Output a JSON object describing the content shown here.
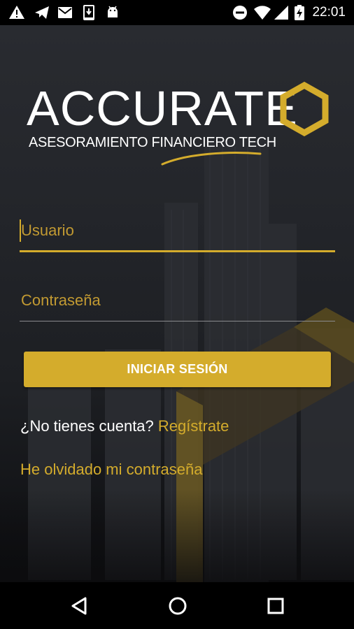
{
  "status_bar": {
    "left_icons": [
      "warning-icon",
      "send-icon",
      "mail-icon",
      "download-icon",
      "android-icon"
    ],
    "right_icons": [
      "do-not-disturb-icon",
      "wifi-icon",
      "signal-icon",
      "battery-charging-icon"
    ],
    "time": "22:01"
  },
  "logo": {
    "title": "ACCURATE",
    "subtitle": "ASESORAMIENTO FINANCIERO TECH",
    "mark_icon": "hexagon-logo-icon",
    "brand_color": "#d4ac2c"
  },
  "form": {
    "username_placeholder": "Usuario",
    "username_value": "",
    "password_placeholder": "Contraseña",
    "password_value": "",
    "login_label": "INICIAR SESIÓN"
  },
  "signup": {
    "question": "¿No tienes cuenta?",
    "link_label": "Regístrate"
  },
  "forgot_password_label": "He olvidado mi contraseña",
  "nav_bar": {
    "back_icon": "back-icon",
    "home_icon": "home-icon",
    "recents_icon": "recents-icon"
  },
  "colors": {
    "accent": "#d4ac2c",
    "placeholder": "#c29a32",
    "background": "#1d1f23"
  }
}
